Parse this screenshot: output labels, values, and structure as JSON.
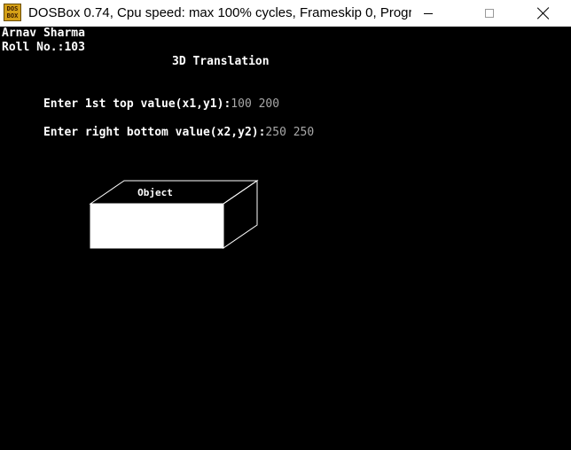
{
  "window": {
    "title": "DOSBox 0.74, Cpu speed: max 100% cycles, Frameskip  0, Progra...",
    "icon_text": "DOS BOX",
    "icon_semantic": "dosbox-icon"
  },
  "console": {
    "name_line": "Arnav Sharma",
    "roll_line": "Roll No.:103",
    "heading": "3D Translation",
    "prompt1_label": "Enter 1st top value(x1,y1):",
    "prompt1_value": "100 200",
    "prompt2_label": "Enter right bottom value(x2,y2):",
    "prompt2_value": "250 250"
  },
  "object": {
    "label": "Object",
    "face_color": "#ffffff",
    "edge_color": "#ffffff"
  },
  "colors": {
    "background": "#000000",
    "text": "#ffffff",
    "input_text": "#a8a8a8",
    "titlebar": "#ffffff"
  }
}
